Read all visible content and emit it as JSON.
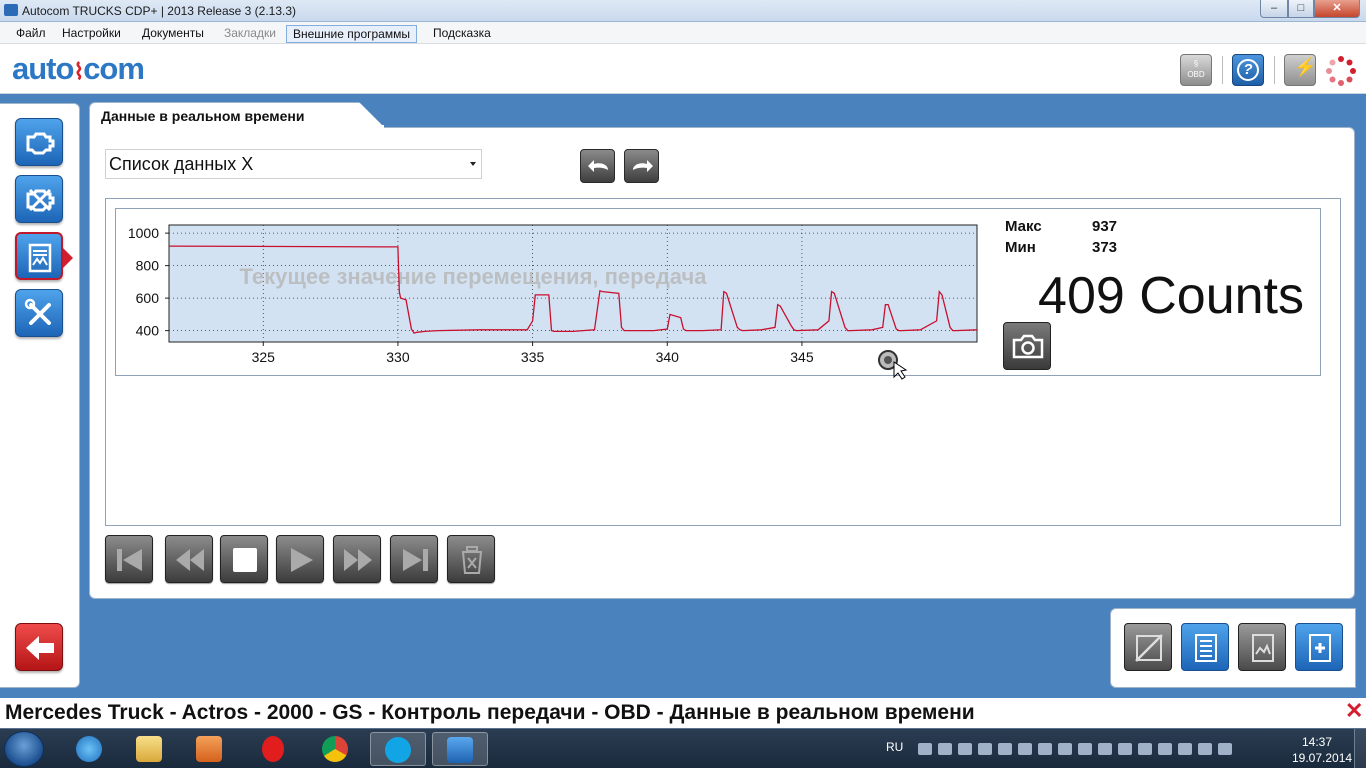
{
  "window": {
    "title": "Autocom TRUCKS CDP+ | 2013 Release 3 (2.13.3)"
  },
  "menu": [
    {
      "label": "Файл",
      "state": "normal"
    },
    {
      "label": "Настройки",
      "state": "normal"
    },
    {
      "label": "Документы",
      "state": "normal"
    },
    {
      "label": "Закладки",
      "state": "disabled"
    },
    {
      "label": "Внешние программы",
      "state": "active"
    },
    {
      "label": "Подсказка",
      "state": "normal"
    }
  ],
  "header": {
    "logo_text": "auto",
    "logo_text2": "com",
    "obd_label": "OBD",
    "obd_symbol": "§",
    "help_symbol": "?"
  },
  "tab": {
    "label": "Данные в реальном времени"
  },
  "list_select": {
    "value": "Список данных X"
  },
  "chart_data": {
    "type": "line",
    "title": "Текущее значение перемещения, передача",
    "xlim": [
      321.5,
      351.5
    ],
    "ylim": [
      330,
      1050
    ],
    "x_ticks": [
      325,
      330,
      335,
      340,
      345
    ],
    "y_ticks": [
      400,
      600,
      800,
      1000
    ],
    "series": [
      {
        "color": "#c8102e",
        "x": [
          321.5,
          330.0,
          330.05,
          330.1,
          330.3,
          330.5,
          330.6,
          330.7,
          331.0,
          331.5,
          333.0,
          334.0,
          334.8,
          335.0,
          335.1,
          335.6,
          335.7,
          335.8,
          336.5,
          337.3,
          337.5,
          337.6,
          338.2,
          338.3,
          338.4,
          339.0,
          339.5,
          340.0,
          340.1,
          340.5,
          340.6,
          340.7,
          341.3,
          342.0,
          342.1,
          342.2,
          342.6,
          342.7,
          342.8,
          343.5,
          344.0,
          344.1,
          344.2,
          344.6,
          344.7,
          344.8,
          345.6,
          346.0,
          346.1,
          346.2,
          346.6,
          346.7,
          346.8,
          347.6,
          348.0,
          348.1,
          348.2,
          348.5,
          348.6,
          348.7,
          349.4,
          350.0,
          350.1,
          350.2,
          350.5,
          350.6,
          350.7,
          351.5
        ],
        "y": [
          920,
          915,
          640,
          600,
          590,
          410,
          385,
          390,
          395,
          400,
          405,
          405,
          405,
          460,
          620,
          620,
          400,
          395,
          395,
          405,
          645,
          640,
          630,
          420,
          400,
          400,
          400,
          410,
          500,
          480,
          410,
          400,
          400,
          405,
          640,
          630,
          420,
          405,
          400,
          405,
          420,
          560,
          550,
          430,
          405,
          400,
          405,
          460,
          640,
          630,
          420,
          400,
          400,
          405,
          420,
          560,
          560,
          410,
          400,
          400,
          405,
          460,
          640,
          620,
          420,
          400,
          400,
          405
        ]
      }
    ]
  },
  "stats": {
    "max_label": "Макс",
    "max_value": "937",
    "min_label": "Мин",
    "min_value": "373",
    "current": "409 Counts"
  },
  "playback": [
    "first",
    "rewind",
    "stop",
    "play",
    "fast-forward",
    "last",
    "clear"
  ],
  "breadcrumb": "Mercedes Truck - Actros - 2000 - GS - Контроль передачи - OBD - Данные в реальном времени",
  "taskbar": {
    "lang": "RU",
    "time": "14:37",
    "date": "19.07.2014"
  },
  "colors": {
    "accent_blue": "#2d78c4",
    "background": "#4a82bd",
    "chart_bg": "#d3e2f3",
    "series": "#c8102e"
  }
}
